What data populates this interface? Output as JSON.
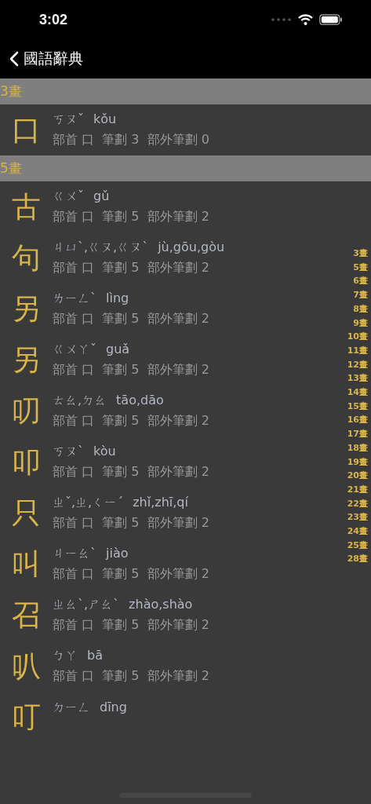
{
  "status_bar": {
    "time": "3:02"
  },
  "nav": {
    "back_title": "國語辭典"
  },
  "sections": [
    {
      "header": "3畫",
      "entries": [
        {
          "char": "口",
          "zhuyin": "ㄎㄡˇ",
          "pinyin": "kǒu",
          "info": "部首 口  筆劃 3  部外筆劃 0"
        }
      ]
    },
    {
      "header": "5畫",
      "entries": [
        {
          "char": "古",
          "zhuyin": "ㄍㄨˇ",
          "pinyin": "gǔ",
          "info": "部首 口  筆劃 5  部外筆劃 2"
        },
        {
          "char": "句",
          "zhuyin": "ㄐㄩˋ,ㄍㄡ,ㄍㄡˋ",
          "pinyin": "jù,gōu,gòu",
          "info": "部首 口  筆劃 5  部外筆劃 2"
        },
        {
          "char": "另",
          "zhuyin": "ㄌㄧㄥˋ",
          "pinyin": "lìng",
          "info": "部首 口  筆劃 5  部外筆劃 2"
        },
        {
          "char": "另",
          "zhuyin": "ㄍㄨㄚˇ",
          "pinyin": "guǎ",
          "info": "部首 口  筆劃 5  部外筆劃 2"
        },
        {
          "char": "叨",
          "zhuyin": "ㄊㄠ,ㄉㄠ",
          "pinyin": "tāo,dāo",
          "info": "部首 口  筆劃 5  部外筆劃 2"
        },
        {
          "char": "叩",
          "zhuyin": "ㄎㄡˋ",
          "pinyin": "kòu",
          "info": "部首 口  筆劃 5  部外筆劃 2"
        },
        {
          "char": "只",
          "zhuyin": "ㄓˇ,ㄓ,ㄑㄧˊ",
          "pinyin": "zhǐ,zhī,qí",
          "info": "部首 口  筆劃 5  部外筆劃 2"
        },
        {
          "char": "叫",
          "zhuyin": "ㄐㄧㄠˋ",
          "pinyin": "jiào",
          "info": "部首 口  筆劃 5  部外筆劃 2"
        },
        {
          "char": "召",
          "zhuyin": "ㄓㄠˋ,ㄕㄠˋ",
          "pinyin": "zhào,shào",
          "info": "部首 口  筆劃 5  部外筆劃 2"
        },
        {
          "char": "叭",
          "zhuyin": "ㄅㄚ",
          "pinyin": "bā",
          "info": "部首 口  筆劃 5  部外筆劃 2"
        },
        {
          "char": "叮",
          "zhuyin": "ㄉㄧㄥ",
          "pinyin": "dīng"
        }
      ]
    }
  ],
  "index": [
    "3畫",
    "5畫",
    "6畫",
    "7畫",
    "8畫",
    "9畫",
    "10畫",
    "11畫",
    "12畫",
    "13畫",
    "14畫",
    "15畫",
    "16畫",
    "17畫",
    "18畫",
    "19畫",
    "20畫",
    "21畫",
    "22畫",
    "23畫",
    "24畫",
    "25畫",
    "28畫"
  ]
}
